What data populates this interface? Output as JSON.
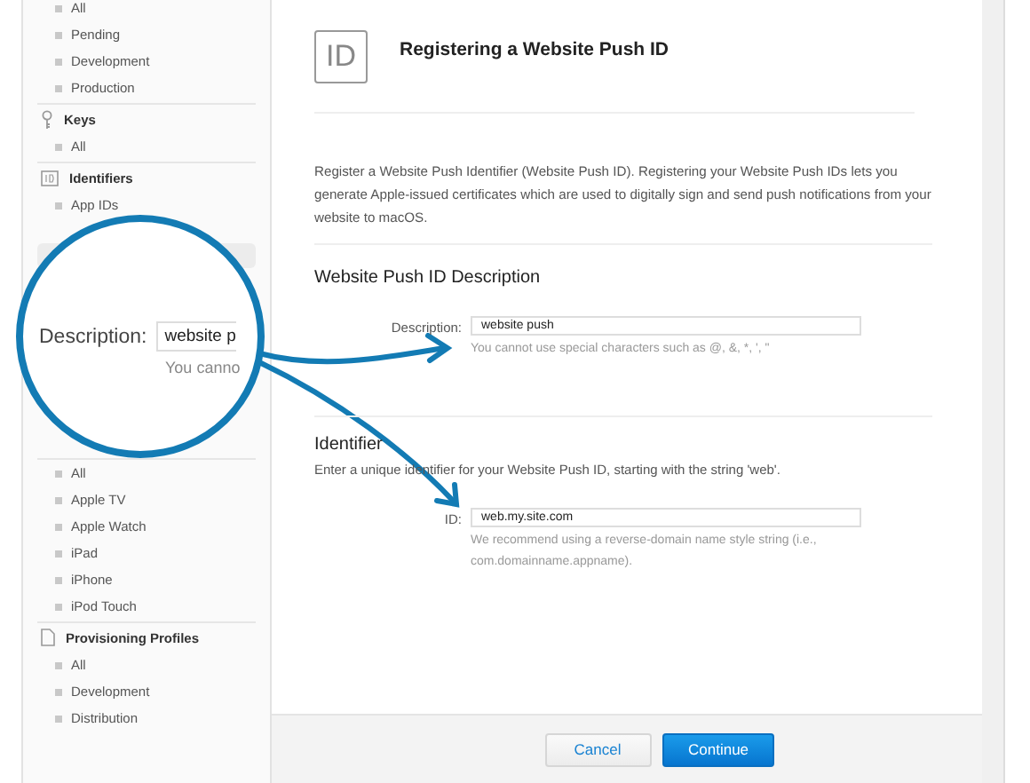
{
  "sidebar": {
    "groups": [
      {
        "items": [
          "All",
          "Pending",
          "Development",
          "Production"
        ]
      },
      {
        "title": "Keys",
        "kind": "key",
        "items": [
          "All"
        ]
      },
      {
        "title": "Identifiers",
        "kind": "id",
        "items": [
          "App IDs"
        ],
        "covered": true
      },
      {
        "items": [
          "All",
          "Apple TV",
          "Apple Watch",
          "iPad",
          "iPhone",
          "iPod Touch"
        ]
      },
      {
        "title": "Provisioning Profiles",
        "kind": "document",
        "items": [
          "All",
          "Development",
          "Distribution"
        ]
      }
    ]
  },
  "header": {
    "icon_text": "ID",
    "title": "Registering a Website Push ID"
  },
  "intro": "Register a Website Push Identifier (Website Push ID). Registering your Website Push IDs lets you generate Apple-issued certificates which are used to digitally sign and send push notifications from your website to macOS.",
  "description_section": {
    "title": "Website Push ID Description",
    "label": "Description:",
    "value": "website push",
    "hint": "You cannot use special characters such as @, &, *, ', \""
  },
  "identifier_section": {
    "title": "Identifier",
    "subtitle": "Enter a unique identifier for your Website Push ID, starting with the string 'web'.",
    "label": "ID:",
    "value": "web.my.site.com",
    "hint": "We recommend using a reverse-domain name style string (i.e., com.domainname.appname)."
  },
  "magnifier": {
    "label": "Description:",
    "value": "website p",
    "hint": "You canno"
  },
  "buttons": [
    {
      "label": "Cancel",
      "kind": "secondary"
    },
    {
      "label": "Continue",
      "kind": "primary"
    }
  ]
}
